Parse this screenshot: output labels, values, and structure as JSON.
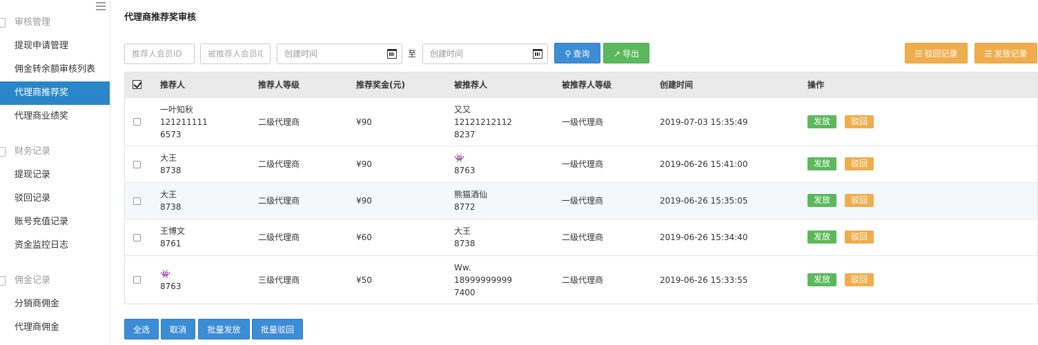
{
  "sidebar": {
    "groups": [
      {
        "label": "审核管理",
        "items": [
          "提现申请管理",
          "佣金转余额审核列表",
          "代理商推荐奖",
          "代理商业绩奖"
        ]
      },
      {
        "label": "财务记录",
        "items": [
          "提现记录",
          "驳回记录",
          "账号充值记录",
          "资金监控日志"
        ]
      },
      {
        "label": "佣金记录",
        "items": [
          "分销商佣金",
          "代理商佣金"
        ]
      }
    ],
    "active_item": "代理商推荐奖"
  },
  "page": {
    "title": "代理商推荐奖审核"
  },
  "filters": {
    "referrer_id_placeholder": "推荐人会员ID",
    "referee_id_placeholder": "被推荐人会员ID",
    "start_time_placeholder": "创建时间",
    "to_label": "至",
    "end_time_placeholder": "创建时间",
    "search_label": "查询",
    "export_label": "导出",
    "reject_records_label": "驳回记录",
    "issue_records_label": "发放记录"
  },
  "table": {
    "headers": [
      "推荐人",
      "推荐人等级",
      "推荐奖金(元)",
      "被推荐人",
      "被推荐人等级",
      "创建时间",
      "操作"
    ],
    "rows": [
      {
        "referrer": [
          "一叶知秋",
          "121211111",
          "6573"
        ],
        "referrer_level": "二级代理商",
        "bonus": "¥90",
        "referee": [
          "又又",
          "12121212112",
          "8237"
        ],
        "referee_level": "一级代理商",
        "time": "2019-07-03 15:35:49"
      },
      {
        "referrer": [
          "大王",
          "8738"
        ],
        "referrer_level": "二级代理商",
        "bonus": "¥90",
        "referee": [
          "👾",
          "8763"
        ],
        "referee_level": "一级代理商",
        "time": "2019-06-26 15:41:00"
      },
      {
        "referrer": [
          "大王",
          "8738"
        ],
        "referrer_level": "二级代理商",
        "bonus": "¥90",
        "referee": [
          "熊猫酒仙",
          "8772"
        ],
        "referee_level": "一级代理商",
        "time": "2019-06-26 15:35:05"
      },
      {
        "referrer": [
          "王博文",
          "8761"
        ],
        "referrer_level": "二级代理商",
        "bonus": "¥60",
        "referee": [
          "大王",
          "8738"
        ],
        "referee_level": "二级代理商",
        "time": "2019-06-26 15:34:40"
      },
      {
        "referrer": [
          "👾",
          "8763"
        ],
        "referrer_level": "三级代理商",
        "bonus": "¥50",
        "referee": [
          "Ww.",
          "18999999999",
          "7400"
        ],
        "referee_level": "二级代理商",
        "time": "2019-06-26 15:33:55"
      }
    ],
    "action_issue": "发放",
    "action_reject": "驳回"
  },
  "footer": {
    "select_all": "全选",
    "cancel": "取消",
    "batch_issue": "批量发放",
    "batch_reject": "批量驳回"
  },
  "colors": {
    "primary": "#3c8dd6",
    "success": "#5cb85c",
    "warning": "#f0ad4e",
    "active_nav": "#2a86c9"
  }
}
